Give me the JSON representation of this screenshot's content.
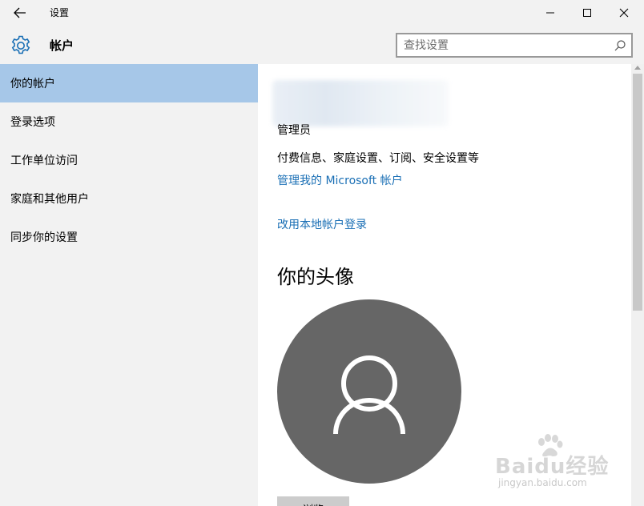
{
  "window": {
    "title": "设置",
    "back_icon": "arrow-left-icon",
    "controls": [
      "minimize-icon",
      "maximize-icon",
      "close-icon"
    ]
  },
  "header": {
    "icon": "gear-icon",
    "title": "帐户",
    "search": {
      "placeholder": "查找设置",
      "value": "",
      "icon": "search-icon"
    }
  },
  "sidebar": {
    "items": [
      {
        "label": "你的帐户",
        "active": true
      },
      {
        "label": "登录选项",
        "active": false
      },
      {
        "label": "工作单位访问",
        "active": false
      },
      {
        "label": "家庭和其他用户",
        "active": false
      },
      {
        "label": "同步你的设置",
        "active": false
      }
    ]
  },
  "account": {
    "role": "管理员",
    "info": "付费信息、家庭设置、订阅、安全设置等",
    "manage_link": "管理我的 Microsoft 帐户",
    "local_link": "改用本地帐户登录"
  },
  "avatar_section": {
    "heading": "你的头像",
    "avatar_icon": "user-icon",
    "browse_button": "浏览"
  },
  "watermark": {
    "brand": "Baidu经验",
    "url": "jingyan.baidu.com"
  },
  "colors": {
    "accent_selected": "#a6c7e8",
    "link": "#1a6fb5",
    "avatar_bg": "#666666",
    "chrome_bg": "#f2f2f2"
  }
}
